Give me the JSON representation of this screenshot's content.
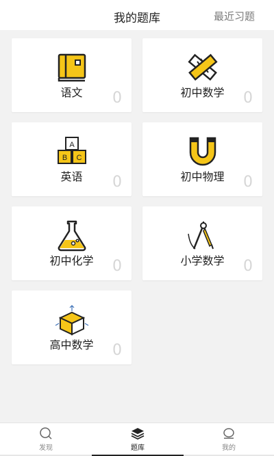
{
  "header": {
    "title": "我的题库",
    "recent_label": "最近习题"
  },
  "subjects": [
    {
      "label": "语文",
      "count": "0",
      "icon": "book-icon"
    },
    {
      "label": "初中数学",
      "count": "0",
      "icon": "ruler-pencil-icon"
    },
    {
      "label": "英语",
      "count": "0",
      "icon": "abc-blocks-icon"
    },
    {
      "label": "初中物理",
      "count": "0",
      "icon": "magnet-icon"
    },
    {
      "label": "初中化学",
      "count": "0",
      "icon": "flask-icon"
    },
    {
      "label": "小学数学",
      "count": "0",
      "icon": "compass-icon"
    },
    {
      "label": "高中数学",
      "count": "0",
      "icon": "cube-icon"
    }
  ],
  "abc_letters": [
    "A",
    "B",
    "C"
  ],
  "tabs": [
    {
      "label": "发现",
      "icon": "search-icon",
      "active": false
    },
    {
      "label": "题库",
      "icon": "layers-icon",
      "active": true
    },
    {
      "label": "我的",
      "icon": "user-icon",
      "active": false
    }
  ],
  "colors": {
    "accent": "#f5c518",
    "indicator_dark": "#222222",
    "indicator_light": "#e6e6e6"
  }
}
